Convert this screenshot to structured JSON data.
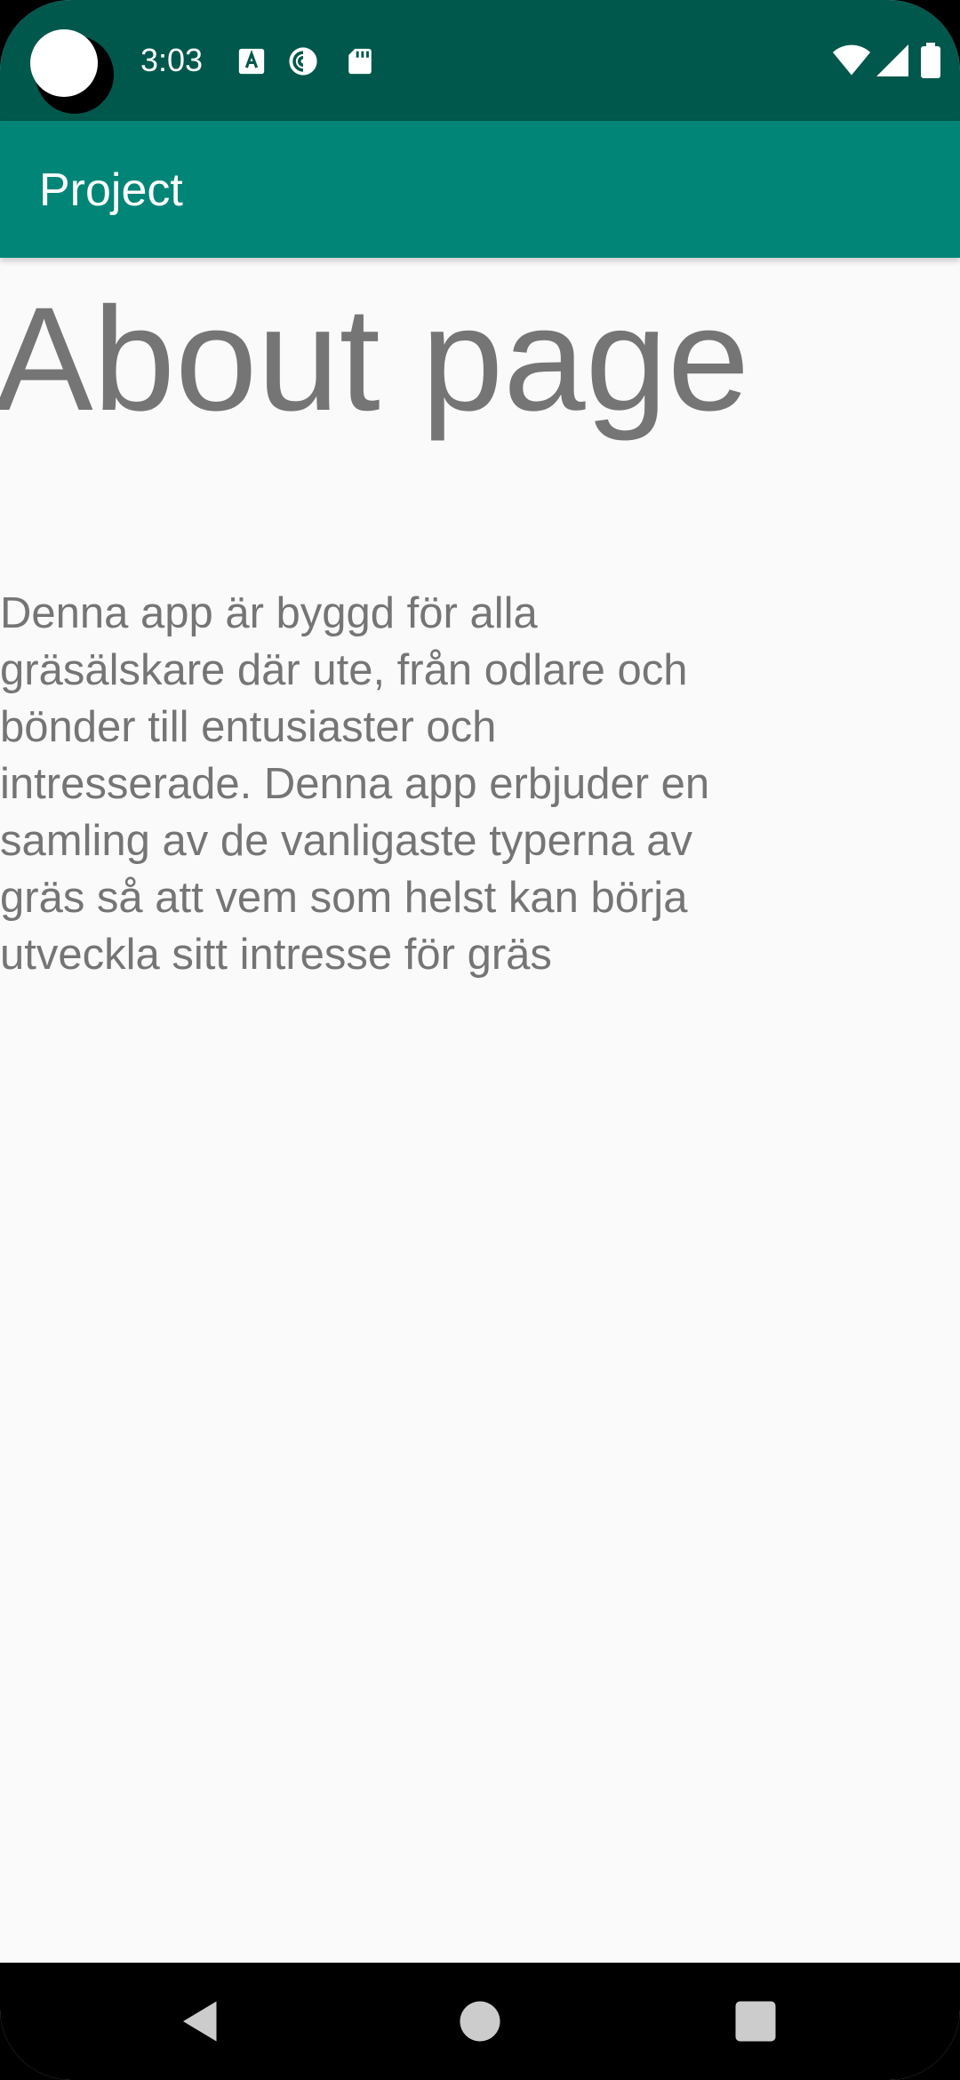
{
  "status_bar": {
    "time": "3:03",
    "left_icons": [
      "font-a-icon",
      "pocket-casts-icon",
      "sd-card-icon"
    ],
    "right_icons": [
      "wifi-icon",
      "cell-signal-icon",
      "battery-icon"
    ]
  },
  "toolbar": {
    "title": "Project"
  },
  "main": {
    "heading": "About page",
    "description": "Denna app är byggd för alla gräsälskare där ute, från odlare och bönder till entusiaster och intresserade. Denna app erbjuder en samling av de vanligaste typerna av gräs så att vem som helst kan börja utveckla sitt intresse för gräs"
  },
  "nav_bar": {
    "buttons": [
      "back-icon",
      "home-icon",
      "recents-icon"
    ]
  },
  "colors": {
    "status_bar": "#00574b",
    "toolbar": "#008577",
    "background": "#fafafa",
    "text": "#757575"
  }
}
